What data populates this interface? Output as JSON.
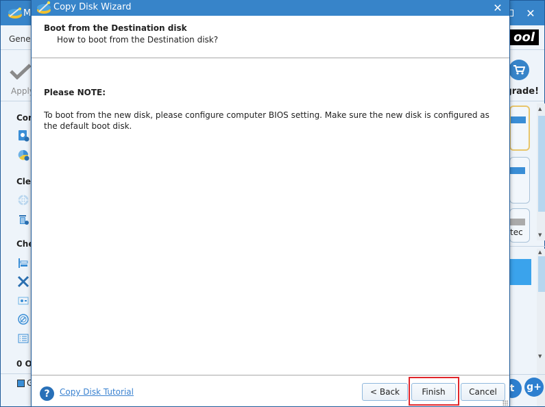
{
  "background_app": {
    "title_partial": "Mi",
    "menu_partial": "Gener",
    "logo_partial": "ool",
    "toolbar": {
      "apply_label": "Apply",
      "upgrade_label": "grade!"
    },
    "sidebar": {
      "sections": [
        {
          "label": "Con",
          "icons": [
            "disk-copy-icon",
            "partition-wizard-icon"
          ]
        },
        {
          "label": "Clea",
          "icons": [
            "disk-wipe-icon",
            "trash-icon"
          ]
        },
        {
          "label": "Che",
          "icons": [
            "align-icon",
            "tools-icon",
            "drive-icon",
            "surface-test-icon",
            "list-icon"
          ]
        }
      ],
      "operations_partial": "0 O",
      "legend_partial": "G"
    },
    "right_panel": {
      "disk_label_partial": "tec"
    },
    "colors": {
      "titlebar": "#3784c9",
      "panel_bg": "#eef4fa",
      "accent": "#3a8ed6"
    }
  },
  "dialog": {
    "title": "Copy Disk Wizard",
    "close_label": "✕",
    "heading": "Boot from the Destination disk",
    "subheading": "How to boot from the Destination disk?",
    "note_title": "Please NOTE:",
    "note_text": "To boot from the new disk, please configure computer BIOS setting. Make sure the new disk is configured as the default boot disk.",
    "footer": {
      "help_icon_glyph": "?",
      "tutorial_link": "Copy Disk Tutorial",
      "buttons": {
        "back": "< Back",
        "finish": "Finish",
        "cancel": "Cancel"
      },
      "highlighted_button": "finish"
    },
    "colors": {
      "titlebar": "#3784c9",
      "link": "#3a82d0",
      "highlight": "#e0252a"
    }
  }
}
